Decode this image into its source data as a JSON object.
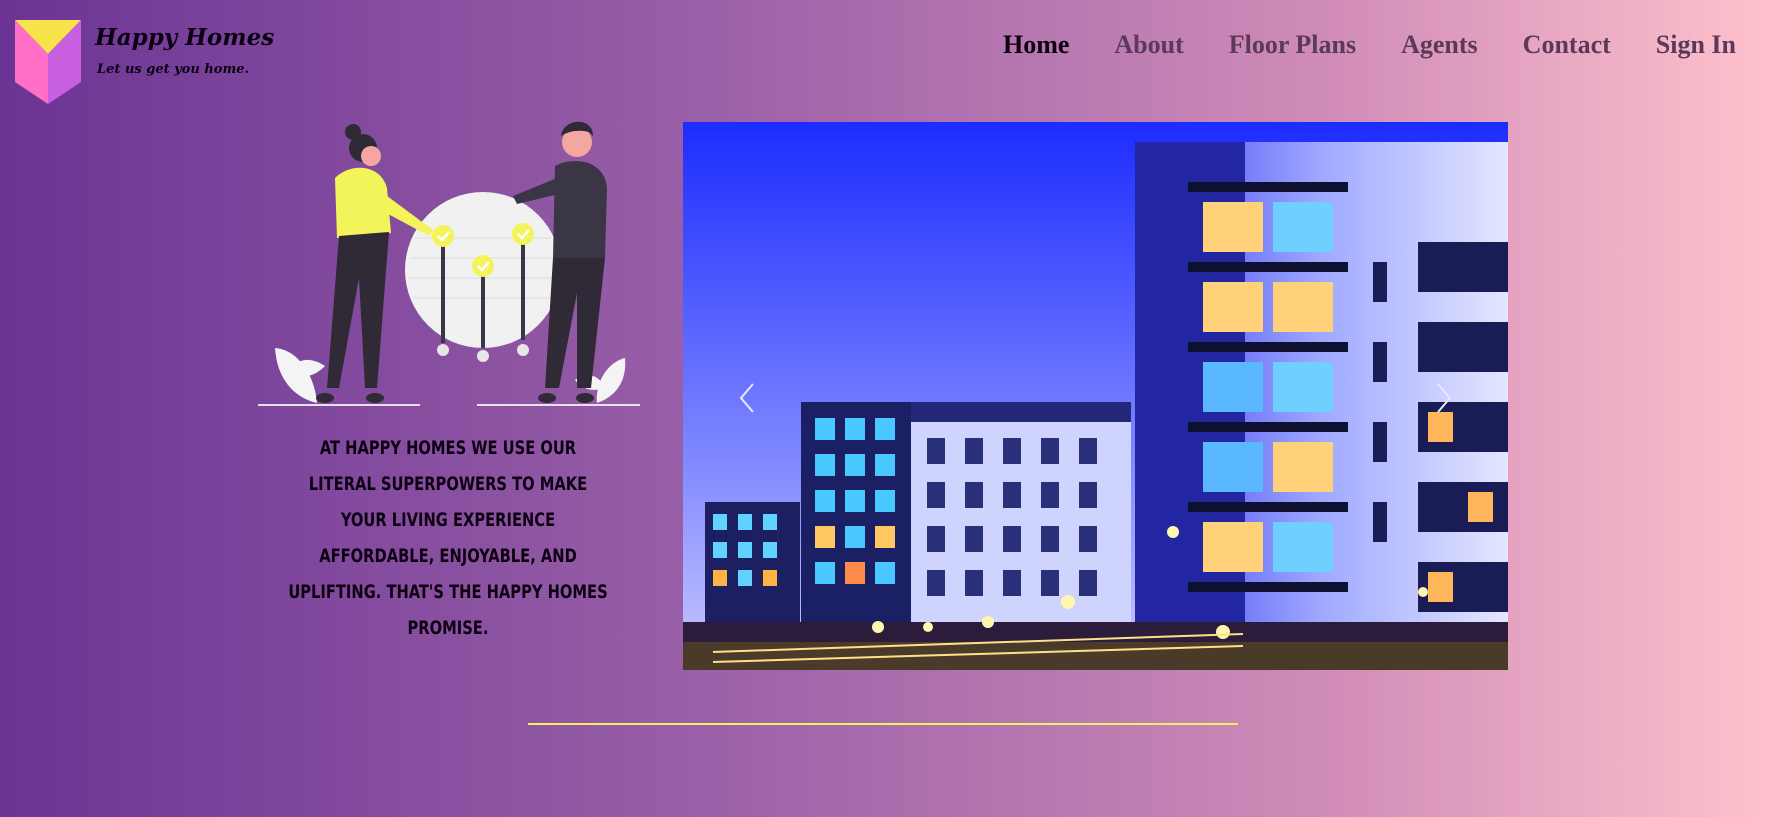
{
  "brand": {
    "title": "Happy Homes",
    "tagline": "Let us get you home.",
    "logo_icon": "house-logo-icon"
  },
  "nav": {
    "items": [
      {
        "label": "Home",
        "active": true
      },
      {
        "label": "About"
      },
      {
        "label": "Floor Plans"
      },
      {
        "label": "Agents"
      },
      {
        "label": "Contact"
      },
      {
        "label": "Sign In"
      }
    ]
  },
  "hero": {
    "promise": "At Happy Homes we use our literal superpowers to make your living experience affordable, enjoyable, and uplifting. That's the Happy Homes promise."
  },
  "carousel": {
    "prev_icon": "chevron-left-icon",
    "next_icon": "chevron-right-icon"
  },
  "colors": {
    "gradient_start": "#6b3494",
    "gradient_end": "#ffc1cc",
    "accent_yellow": "#f2ee66",
    "logo_pink": "#ff6fc8",
    "logo_yellow": "#f7e34a",
    "text_dark": "#0d0010",
    "nav_muted": "#5a3a58"
  }
}
